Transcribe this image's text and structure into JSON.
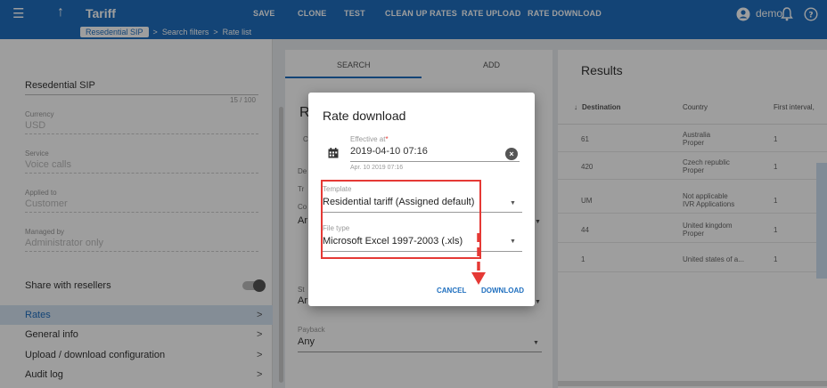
{
  "header": {
    "title": "Tariff",
    "buttons": [
      "SAVE",
      "CLONE",
      "TEST",
      "CLEAN UP RATES",
      "RATE UPLOAD",
      "RATE DOWNLOAD"
    ],
    "user": "demo",
    "breadcrumbs": [
      "Resedential SIP",
      "Search filters",
      "Rate list"
    ],
    "accent": "#1f6fbf"
  },
  "left_panel": {
    "name": "Resedential SIP",
    "name_count": "15 / 100",
    "fields": [
      {
        "label": "Currency",
        "value": "USD"
      },
      {
        "label": "Service",
        "value": "Voice calls"
      },
      {
        "label": "Applied to",
        "value": "Customer"
      },
      {
        "label": "Managed by",
        "value": "Administrator only"
      }
    ],
    "share_label": "Share with resellers",
    "menu": [
      "Rates",
      "General info",
      "Upload / download configuration",
      "Audit log"
    ]
  },
  "middle_panel": {
    "tabs": [
      "SEARCH",
      "ADD"
    ],
    "heading_fragment": "R",
    "fragments": [
      "C",
      "De",
      "Tr",
      "Co",
      "Ar",
      "St",
      "Ar"
    ],
    "payback_label": "Payback",
    "payback_value": "Any"
  },
  "results": {
    "title": "Results",
    "columns": [
      "Destination",
      "Country",
      "First interval,"
    ],
    "rows": [
      {
        "destination": "61",
        "country": [
          "Australia",
          "Proper"
        ],
        "first_interval": "1"
      },
      {
        "destination": "420",
        "country": [
          "Czech republic",
          "Proper"
        ],
        "first_interval": "1"
      },
      {
        "destination": "UM",
        "country": [
          "Not applicable",
          "IVR Applications"
        ],
        "first_interval": "1"
      },
      {
        "destination": "44",
        "country": [
          "United kingdom",
          "Proper"
        ],
        "first_interval": "1"
      },
      {
        "destination": "1",
        "country": [
          "United states of a..."
        ],
        "first_interval": "1"
      }
    ]
  },
  "dialog": {
    "title": "Rate download",
    "effective_label": "Effective at",
    "effective_required": "*",
    "effective_value": "2019-04-10 07:16",
    "effective_hint": "Apr. 10 2019 07:16",
    "template_label": "Template",
    "template_value": "Residential tariff (Assigned default)",
    "filetype_label": "File type",
    "filetype_value": "Microsoft Excel 1997-2003 (.xls)",
    "cancel_label": "CANCEL",
    "download_label": "DOWNLOAD",
    "highlight_color": "#e53935"
  }
}
